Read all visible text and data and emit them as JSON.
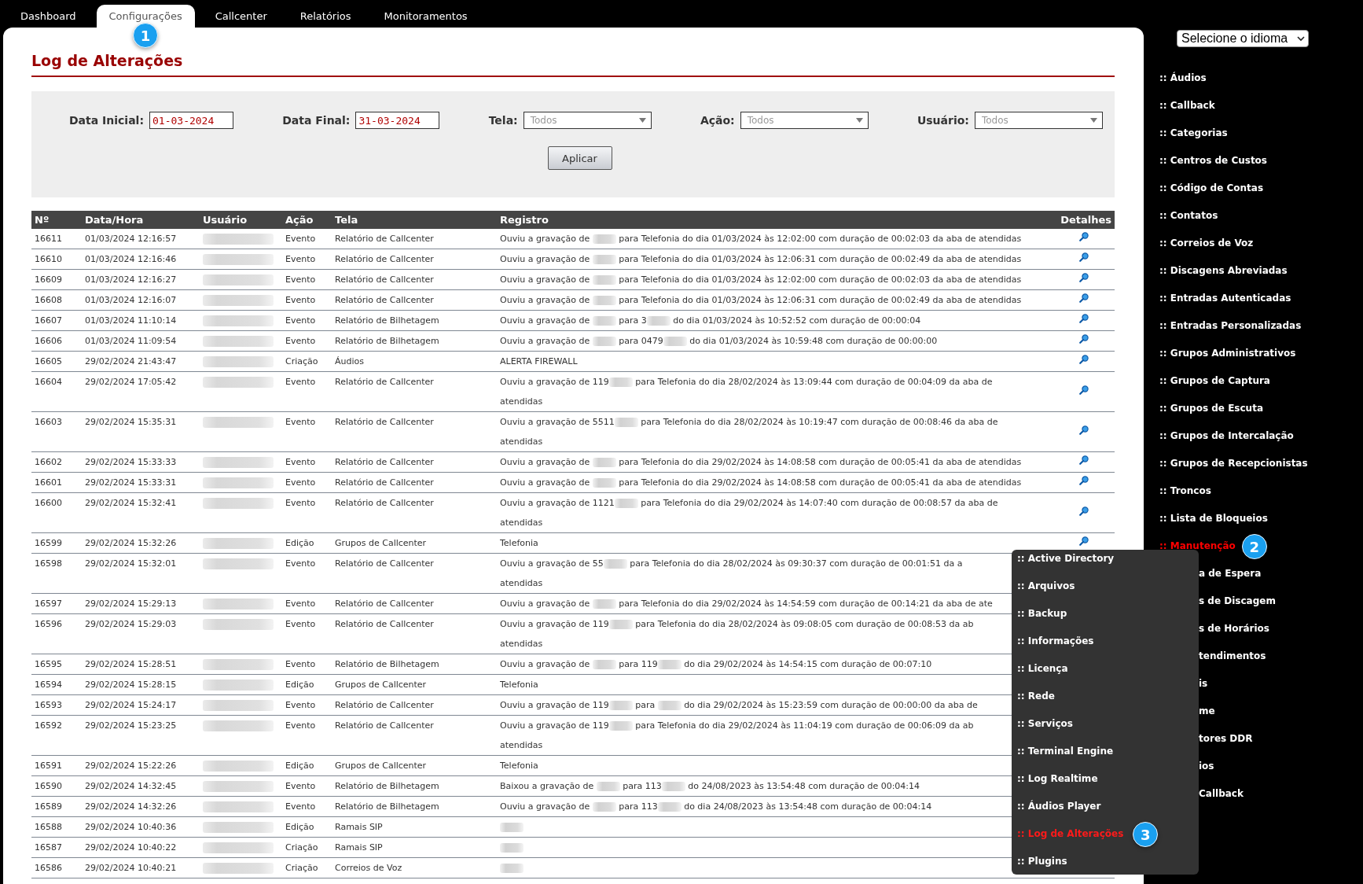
{
  "tabs": [
    {
      "label": "Dashboard",
      "selected": false
    },
    {
      "label": "Configurações",
      "selected": true,
      "badge": "1"
    },
    {
      "label": "Callcenter",
      "selected": false
    },
    {
      "label": "Relatórios",
      "selected": false
    },
    {
      "label": "Monitoramentos",
      "selected": false
    }
  ],
  "page_title": "Log de Alterações",
  "filters": {
    "data_inicial": {
      "label": "Data Inicial:",
      "value": "01-03-2024"
    },
    "data_final": {
      "label": "Data Final:",
      "value": "31-03-2024"
    },
    "selects": [
      {
        "label": "Tela:",
        "placeholder": "Todos"
      },
      {
        "label": "Ação:",
        "placeholder": "Todos"
      },
      {
        "label": "Usuário:",
        "placeholder": "Todos"
      }
    ],
    "apply_button": "Aplicar"
  },
  "table": {
    "columns": [
      "Nº",
      "Data/Hora",
      "Usuário",
      "Ação",
      "Tela",
      "Registro",
      "Detalhes"
    ],
    "rows": [
      {
        "no": "16611",
        "data": "01/03/2024 12:16:57",
        "acao": "Evento",
        "tela": "Relatório de Callcenter",
        "details_icon": true,
        "registro": [
          [
            {
              "kind": "text",
              "text": "Ouviu a gravação de "
            },
            {
              "kind": "blur"
            },
            {
              "kind": "text",
              "text": " para Telefonia do dia 01/03/2024 às 12:02:00 com duração de 00:02:03 da aba de atendidas"
            }
          ]
        ]
      },
      {
        "no": "16610",
        "data": "01/03/2024 12:16:46",
        "acao": "Evento",
        "tela": "Relatório de Callcenter",
        "details_icon": true,
        "registro": [
          [
            {
              "kind": "text",
              "text": "Ouviu a gravação de "
            },
            {
              "kind": "blur"
            },
            {
              "kind": "text",
              "text": " para Telefonia do dia 01/03/2024 às 12:06:31 com duração de 00:02:49 da aba de atendidas"
            }
          ]
        ]
      },
      {
        "no": "16609",
        "data": "01/03/2024 12:16:27",
        "acao": "Evento",
        "tela": "Relatório de Callcenter",
        "details_icon": true,
        "registro": [
          [
            {
              "kind": "text",
              "text": "Ouviu a gravação de "
            },
            {
              "kind": "blur"
            },
            {
              "kind": "text",
              "text": " para Telefonia do dia 01/03/2024 às 12:02:00 com duração de 00:02:03 da aba de atendidas"
            }
          ]
        ]
      },
      {
        "no": "16608",
        "data": "01/03/2024 12:16:07",
        "acao": "Evento",
        "tela": "Relatório de Callcenter",
        "details_icon": true,
        "registro": [
          [
            {
              "kind": "text",
              "text": "Ouviu a gravação de "
            },
            {
              "kind": "blur"
            },
            {
              "kind": "text",
              "text": " para Telefonia do dia 01/03/2024 às 12:06:31 com duração de 00:02:49 da aba de atendidas"
            }
          ]
        ]
      },
      {
        "no": "16607",
        "data": "01/03/2024 11:10:14",
        "acao": "Evento",
        "tela": "Relatório de Bilhetagem",
        "details_icon": true,
        "registro": [
          [
            {
              "kind": "text",
              "text": "Ouviu a gravação de "
            },
            {
              "kind": "blur"
            },
            {
              "kind": "text",
              "text": " para 3"
            },
            {
              "kind": "blur"
            },
            {
              "kind": "text",
              "text": " do dia 01/03/2024 às 10:52:52 com duração de 00:00:04"
            }
          ]
        ]
      },
      {
        "no": "16606",
        "data": "01/03/2024 11:09:54",
        "acao": "Evento",
        "tela": "Relatório de Bilhetagem",
        "details_icon": true,
        "registro": [
          [
            {
              "kind": "text",
              "text": "Ouviu a gravação de "
            },
            {
              "kind": "blur"
            },
            {
              "kind": "text",
              "text": " para 0479"
            },
            {
              "kind": "blur"
            },
            {
              "kind": "text",
              "text": " do dia 01/03/2024 às 10:59:48 com duração de 00:00:00"
            }
          ]
        ]
      },
      {
        "no": "16605",
        "data": "29/02/2024 21:43:47",
        "acao": "Criação",
        "tela": "Áudios",
        "details_icon": true,
        "registro": [
          [
            {
              "kind": "text",
              "text": "ALERTA FIREWALL"
            }
          ]
        ]
      },
      {
        "no": "16604",
        "data": "29/02/2024 17:05:42",
        "acao": "Evento",
        "tela": "Relatório de Callcenter",
        "details_icon": true,
        "registro": [
          [
            {
              "kind": "text",
              "text": "Ouviu a gravação de 119"
            },
            {
              "kind": "blur"
            },
            {
              "kind": "text",
              "text": " para Telefonia do dia 28/02/2024 às 13:09:44 com duração de 00:04:09 da aba de"
            }
          ],
          [
            {
              "kind": "text",
              "text": "atendidas"
            }
          ]
        ]
      },
      {
        "no": "16603",
        "data": "29/02/2024 15:35:31",
        "acao": "Evento",
        "tela": "Relatório de Callcenter",
        "details_icon": true,
        "registro": [
          [
            {
              "kind": "text",
              "text": "Ouviu a gravação de 5511"
            },
            {
              "kind": "blur"
            },
            {
              "kind": "text",
              "text": " para Telefonia do dia 28/02/2024 às 10:19:47 com duração de 00:08:46 da aba de"
            }
          ],
          [
            {
              "kind": "text",
              "text": "atendidas"
            }
          ]
        ]
      },
      {
        "no": "16602",
        "data": "29/02/2024 15:33:33",
        "acao": "Evento",
        "tela": "Relatório de Callcenter",
        "details_icon": true,
        "registro": [
          [
            {
              "kind": "text",
              "text": "Ouviu a gravação de "
            },
            {
              "kind": "blur"
            },
            {
              "kind": "text",
              "text": " para Telefonia do dia 29/02/2024 às 14:08:58 com duração de 00:05:41 da aba de atendidas"
            }
          ]
        ]
      },
      {
        "no": "16601",
        "data": "29/02/2024 15:33:31",
        "acao": "Evento",
        "tela": "Relatório de Callcenter",
        "details_icon": true,
        "registro": [
          [
            {
              "kind": "text",
              "text": "Ouviu a gravação de "
            },
            {
              "kind": "blur"
            },
            {
              "kind": "text",
              "text": " para Telefonia do dia 29/02/2024 às 14:08:58 com duração de 00:05:41 da aba de atendidas"
            }
          ]
        ]
      },
      {
        "no": "16600",
        "data": "29/02/2024 15:32:41",
        "acao": "Evento",
        "tela": "Relatório de Callcenter",
        "details_icon": true,
        "registro": [
          [
            {
              "kind": "text",
              "text": "Ouviu a gravação de 1121"
            },
            {
              "kind": "blur"
            },
            {
              "kind": "text",
              "text": " para Telefonia do dia 29/02/2024 às 14:07:40 com duração de 00:08:57 da aba de"
            }
          ],
          [
            {
              "kind": "text",
              "text": "atendidas"
            }
          ]
        ]
      },
      {
        "no": "16599",
        "data": "29/02/2024 15:32:26",
        "acao": "Edição",
        "tela": "Grupos de Callcenter",
        "details_icon": true,
        "registro": [
          [
            {
              "kind": "text",
              "text": "Telefonia"
            }
          ]
        ]
      },
      {
        "no": "16598",
        "data": "29/02/2024 15:32:01",
        "acao": "Evento",
        "tela": "Relatório de Callcenter",
        "details_icon": false,
        "registro": [
          [
            {
              "kind": "text",
              "text": "Ouviu a gravação de 55"
            },
            {
              "kind": "blur"
            },
            {
              "kind": "text",
              "text": " para Telefonia do dia 28/02/2024 às 09:30:37 com duração de 00:01:51 da a"
            }
          ],
          [
            {
              "kind": "text",
              "text": "atendidas"
            }
          ]
        ]
      },
      {
        "no": "16597",
        "data": "29/02/2024 15:29:13",
        "acao": "Evento",
        "tela": "Relatório de Callcenter",
        "details_icon": false,
        "registro": [
          [
            {
              "kind": "text",
              "text": "Ouviu a gravação de "
            },
            {
              "kind": "blur"
            },
            {
              "kind": "text",
              "text": " para Telefonia do dia 29/02/2024 às 14:54:59 com duração de 00:14:21 da aba de ate"
            }
          ]
        ]
      },
      {
        "no": "16596",
        "data": "29/02/2024 15:29:03",
        "acao": "Evento",
        "tela": "Relatório de Callcenter",
        "details_icon": false,
        "registro": [
          [
            {
              "kind": "text",
              "text": "Ouviu a gravação de 119"
            },
            {
              "kind": "blur"
            },
            {
              "kind": "text",
              "text": " para Telefonia do dia 28/02/2024 às 09:08:05 com duração de 00:08:53 da ab"
            }
          ],
          [
            {
              "kind": "text",
              "text": "atendidas"
            }
          ]
        ]
      },
      {
        "no": "16595",
        "data": "29/02/2024 15:28:51",
        "acao": "Evento",
        "tela": "Relatório de Bilhetagem",
        "details_icon": false,
        "registro": [
          [
            {
              "kind": "text",
              "text": "Ouviu a gravação de "
            },
            {
              "kind": "blur"
            },
            {
              "kind": "text",
              "text": " para 119"
            },
            {
              "kind": "blur"
            },
            {
              "kind": "text",
              "text": " do dia 29/02/2024 às 14:54:15 com duração de 00:07:10"
            }
          ]
        ]
      },
      {
        "no": "16594",
        "data": "29/02/2024 15:28:15",
        "acao": "Edição",
        "tela": "Grupos de Callcenter",
        "details_icon": false,
        "registro": [
          [
            {
              "kind": "text",
              "text": "Telefonia"
            }
          ]
        ]
      },
      {
        "no": "16593",
        "data": "29/02/2024 15:24:17",
        "acao": "Evento",
        "tela": "Relatório de Callcenter",
        "details_icon": false,
        "registro": [
          [
            {
              "kind": "text",
              "text": "Ouviu a gravação de 119"
            },
            {
              "kind": "blur"
            },
            {
              "kind": "text",
              "text": " para "
            },
            {
              "kind": "blur"
            },
            {
              "kind": "text",
              "text": " do dia 29/02/2024 às 15:23:59 com duração de 00:00:00 da aba de"
            }
          ]
        ]
      },
      {
        "no": "16592",
        "data": "29/02/2024 15:23:25",
        "acao": "Evento",
        "tela": "Relatório de Callcenter",
        "details_icon": false,
        "registro": [
          [
            {
              "kind": "text",
              "text": "Ouviu a gravação de 119"
            },
            {
              "kind": "blur"
            },
            {
              "kind": "text",
              "text": " para Telefonia do dia 29/02/2024 às 11:04:19 com duração de 00:06:09 da ab"
            }
          ],
          [
            {
              "kind": "text",
              "text": "atendidas"
            }
          ]
        ]
      },
      {
        "no": "16591",
        "data": "29/02/2024 15:22:26",
        "acao": "Edição",
        "tela": "Grupos de Callcenter",
        "details_icon": false,
        "registro": [
          [
            {
              "kind": "text",
              "text": "Telefonia"
            }
          ]
        ]
      },
      {
        "no": "16590",
        "data": "29/02/2024 14:32:45",
        "acao": "Evento",
        "tela": "Relatório de Bilhetagem",
        "details_icon": false,
        "registro": [
          [
            {
              "kind": "text",
              "text": "Baixou a gravação de "
            },
            {
              "kind": "blur"
            },
            {
              "kind": "text",
              "text": " para 113"
            },
            {
              "kind": "blur"
            },
            {
              "kind": "text",
              "text": " do 24/08/2023 às 13:54:48 com duração de 00:04:14"
            }
          ]
        ]
      },
      {
        "no": "16589",
        "data": "29/02/2024 14:32:26",
        "acao": "Evento",
        "tela": "Relatório de Bilhetagem",
        "details_icon": false,
        "registro": [
          [
            {
              "kind": "text",
              "text": "Ouviu a gravação de "
            },
            {
              "kind": "blur"
            },
            {
              "kind": "text",
              "text": " para 113"
            },
            {
              "kind": "blur"
            },
            {
              "kind": "text",
              "text": " do dia 24/08/2023 às 13:54:48 com duração de 00:04:14"
            }
          ]
        ]
      },
      {
        "no": "16588",
        "data": "29/02/2024 10:40:36",
        "acao": "Edição",
        "tela": "Ramais SIP",
        "details_icon": false,
        "registro": [
          [
            {
              "kind": "blur"
            }
          ]
        ]
      },
      {
        "no": "16587",
        "data": "29/02/2024 10:40:22",
        "acao": "Criação",
        "tela": "Ramais SIP",
        "details_icon": false,
        "registro": [
          [
            {
              "kind": "blur"
            }
          ]
        ]
      },
      {
        "no": "16586",
        "data": "29/02/2024 10:40:21",
        "acao": "Criação",
        "tela": "Correios de Voz",
        "details_icon": false,
        "registro": [
          [
            {
              "kind": "blur"
            }
          ]
        ]
      }
    ]
  },
  "language_select": "Selecione o idioma",
  "sidebar": {
    "items": [
      {
        "label": ":: Áudios",
        "selected": false,
        "kind": "link"
      },
      {
        "label": ":: Callback",
        "selected": false,
        "kind": "link"
      },
      {
        "label": ":: Categorias",
        "selected": false,
        "kind": "link"
      },
      {
        "label": ":: Centros de Custos",
        "selected": false,
        "kind": "link"
      },
      {
        "label": ":: Código de Contas",
        "selected": false,
        "kind": "link"
      },
      {
        "label": ":: Contatos",
        "selected": false,
        "kind": "link"
      },
      {
        "label": ":: Correios de Voz",
        "selected": false,
        "kind": "link"
      },
      {
        "label": ":: Discagens Abreviadas",
        "selected": false,
        "kind": "link"
      },
      {
        "label": ":: Entradas Autenticadas",
        "selected": false,
        "kind": "link"
      },
      {
        "label": ":: Entradas Personalizadas",
        "selected": false,
        "kind": "link"
      },
      {
        "label": ":: Grupos Administrativos",
        "selected": false,
        "kind": "link"
      },
      {
        "label": ":: Grupos de Captura",
        "selected": false,
        "kind": "link"
      },
      {
        "label": ":: Grupos de Escuta",
        "selected": false,
        "kind": "link"
      },
      {
        "label": ":: Grupos de Intercalação",
        "selected": false,
        "kind": "link"
      },
      {
        "label": ":: Grupos de Recepcionistas",
        "selected": false,
        "kind": "link"
      },
      {
        "label": ":: Troncos",
        "selected": false,
        "kind": "link"
      },
      {
        "label": ":: Lista de Bloqueios",
        "selected": false,
        "kind": "link"
      },
      {
        "label": ":: Manutenção",
        "selected": true,
        "kind": "link",
        "badge": "2"
      },
      {
        "label": "a de Espera",
        "selected": false,
        "kind": "covered"
      },
      {
        "label": "s de Discagem",
        "selected": false,
        "kind": "covered"
      },
      {
        "label": "s de Horários",
        "selected": false,
        "kind": "covered"
      },
      {
        "label": "tendimentos",
        "selected": false,
        "kind": "covered"
      },
      {
        "label": "is",
        "selected": false,
        "kind": "covered"
      },
      {
        "label": "me",
        "selected": false,
        "kind": "covered"
      },
      {
        "label": "tores DDR",
        "selected": false,
        "kind": "covered"
      },
      {
        "label": "ios",
        "selected": false,
        "kind": "covered"
      },
      {
        "label": "Callback",
        "selected": false,
        "kind": "covered"
      }
    ]
  },
  "submenu": {
    "items": [
      {
        "label": ":: Active Directory",
        "selected": false
      },
      {
        "label": ":: Arquivos",
        "selected": false
      },
      {
        "label": ":: Backup",
        "selected": false
      },
      {
        "label": ":: Informações",
        "selected": false
      },
      {
        "label": ":: Licença",
        "selected": false
      },
      {
        "label": ":: Rede",
        "selected": false
      },
      {
        "label": ":: Serviços",
        "selected": false
      },
      {
        "label": ":: Terminal Engine",
        "selected": false
      },
      {
        "label": ":: Log Realtime",
        "selected": false
      },
      {
        "label": ":: Áudios Player",
        "selected": false
      },
      {
        "label": ":: Log de Alterações",
        "selected": true,
        "badge": "3"
      },
      {
        "label": ":: Plugins",
        "selected": false
      }
    ]
  }
}
